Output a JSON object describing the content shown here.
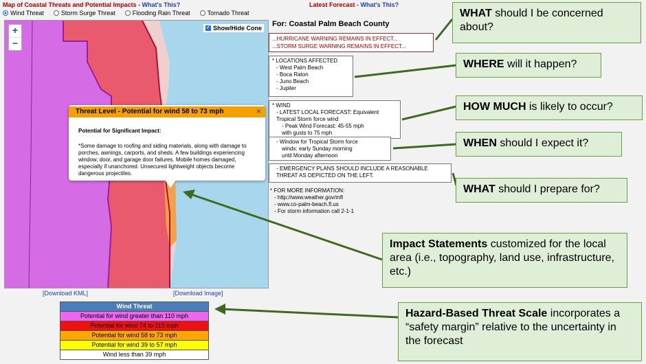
{
  "header": {
    "title": "Map of Coastal Threats and Potential Impacts - ",
    "title_link": "What's This?",
    "latest_label": "Latest Forecast - ",
    "latest_link": "What's This?"
  },
  "tabs": [
    {
      "label": "Wind Threat",
      "selected": true
    },
    {
      "label": "Storm Surge Threat",
      "selected": false
    },
    {
      "label": "Flooding Rain Threat",
      "selected": false
    },
    {
      "label": "Tornado Threat",
      "selected": false
    }
  ],
  "map": {
    "zoom_in": "+",
    "zoom_out": "−",
    "cone_label": "Show/Hide Cone"
  },
  "popup": {
    "header": "Threat  Level  - Potential  for  wind  58 to 73 mph",
    "close": "×",
    "subtitle": "Potential for Significant Impact:",
    "body": "*Some damage to roofing and siding materials, along with damage to porches, awnings, carports, and sheds. A few buildings experiencing window, door, and garage door failures. Mobile homes damaged, especially if unanchored. Unsecured lightweight objects become dangerous projectiles."
  },
  "downloads": {
    "kml": "[Download KML]",
    "image": "[Download Image]"
  },
  "legend": {
    "title": "Wind Threat",
    "rows": [
      {
        "label": "Potential for wind greater than 110 mph",
        "color": "#ee66ee"
      },
      {
        "label": "Potential for wind 74 to 110 mph",
        "color": "#ee1111"
      },
      {
        "label": "Potential for wind 58 to 73 mph",
        "color": "#ffa500"
      },
      {
        "label": "Potential for wind 39 to 57 mph",
        "color": "#ffff00"
      },
      {
        "label": "Wind less than 39 mph",
        "color": "#ffffff"
      }
    ]
  },
  "forecast": {
    "county": "For: Coastal Palm Beach County",
    "warnings": [
      "...HURRICANE WARNING REMAINS IN EFFECT...",
      "...STORM SURGE WARNING REMAINS IN EFFECT..."
    ],
    "locations_title": "* LOCATIONS AFFECTED",
    "locations": [
      "- West Palm Beach",
      "- Boca Raton",
      "- Juno Beach",
      "- Jupiter"
    ],
    "wind_title": "* WIND",
    "wind_lines": [
      "- LATEST LOCAL FORECAST: Equivalent",
      "Tropical Storm force wind",
      "- Peak Wind Forecast: 45-55 mph",
      "with gusts to 75 mph"
    ],
    "window_lines": [
      "- Window for Tropical Storm force",
      "winds: early Sunday morning",
      "until Monday afternoon"
    ],
    "emergency_lines": [
      "- EMERGENCY PLANS SHOULD INCLUDE A REASONABLE",
      "THREAT AS DEPICTED ON THE LEFT."
    ],
    "info_title": "* FOR MORE INFORMATION:",
    "info_lines": [
      "- http://www.weather.gov/mfl",
      "- www.co-palm-beach.fl.us",
      "- For storm information call 2-1-1"
    ]
  },
  "callouts": {
    "what": {
      "bold": "WHAT",
      "rest": " should I be concerned about?"
    },
    "where": {
      "bold": "WHERE",
      "rest": " will it happen?"
    },
    "how_much": {
      "bold": "HOW MUCH",
      "rest": " is likely to occur?"
    },
    "when": {
      "bold": "WHEN",
      "rest": " should I expect it?"
    },
    "prepare": {
      "bold": "WHAT",
      "rest": " should I prepare for?"
    },
    "impact": {
      "bold": "Impact Statements",
      "rest": " customized for the local area (i.e., topography, land use, infrastructure, etc.)"
    },
    "hazard": {
      "bold": "Hazard-Based Threat Scale",
      "rest": " incorporates a “safety margin” relative to the uncertainty in the forecast"
    }
  },
  "colors": {
    "callout_bg": "#dfeed7",
    "arrow": "#3d6a1f",
    "popup_header": "#f5a000"
  }
}
